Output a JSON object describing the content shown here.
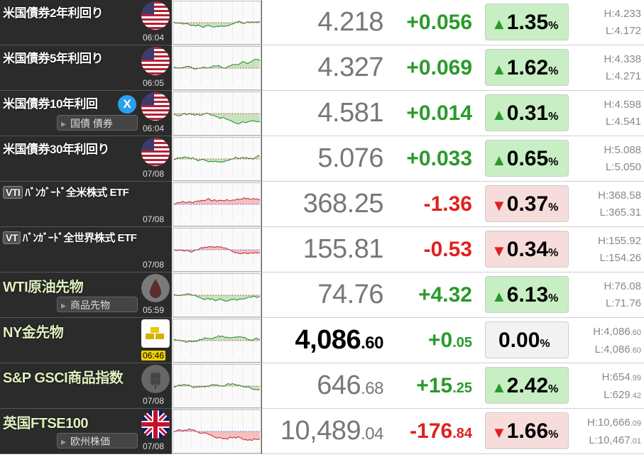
{
  "rows": [
    {
      "name": "米国債券2年利回り",
      "icon": "us-flag-icon",
      "time": "06:04",
      "price": "4.218",
      "change": "+0.056",
      "pct": "1.35",
      "dir": "up",
      "high": "H:4.233",
      "low": "L:4.172"
    },
    {
      "name": "米国債券5年利回り",
      "icon": "us-flag-icon",
      "time": "06:05",
      "price": "4.327",
      "change": "+0.069",
      "pct": "1.62",
      "dir": "up",
      "high": "H:4.338",
      "low": "L:4.271"
    },
    {
      "name": "米国債券10年利回",
      "icon": "us-flag-icon",
      "time": "06:04",
      "price": "4.581",
      "change": "+0.014",
      "pct": "0.31",
      "dir": "up",
      "high": "H:4.598",
      "low": "L:4.541",
      "tag": "国債 債券",
      "x": "X"
    },
    {
      "name": "米国債券30年利回り",
      "icon": "us-flag-icon",
      "time": "07/08",
      "price": "5.076",
      "change": "+0.033",
      "pct": "0.65",
      "dir": "up",
      "high": "H:5.088",
      "low": "L:5.050"
    },
    {
      "name": "ﾊﾞﾝｶﾞｰﾄﾞ全米株式 ETF",
      "badge": "VTI",
      "time": "07/08",
      "price": "368.25",
      "change": "-1.36",
      "pct": "0.37",
      "dir": "down",
      "high": "H:368.58",
      "low": "L:365.31"
    },
    {
      "name": "ﾊﾞﾝｶﾞｰﾄﾞ全世界株式 ETF",
      "badge": "VT",
      "time": "07/08",
      "price": "155.81",
      "change": "-0.53",
      "pct": "0.34",
      "dir": "down",
      "high": "H:155.92",
      "low": "L:154.26"
    },
    {
      "name": "WTI原油先物",
      "icon": "oil-drop-icon",
      "time": "05:59",
      "price": "74.76",
      "change": "+4.32",
      "pct": "6.13",
      "dir": "up",
      "high": "H:76.08",
      "low": "L:71.76",
      "tag": "商品先物"
    },
    {
      "name": "NY金先物",
      "icon": "gold-bars-icon",
      "time": "06:46",
      "price_int": "4,086",
      "price_dec": ".60",
      "change_int": "+0",
      "change_dec": ".05",
      "pct": "0.00",
      "dir": "flat",
      "high_int": "H:4,086",
      "high_dec": ".60",
      "low_int": "L:4,086",
      "low_dec": ".60"
    },
    {
      "name": "S&P GSCI商品指数",
      "icon": "wheat-icon",
      "time": "07/08",
      "price_int": "646",
      "price_dec": ".68",
      "change_int": "+15",
      "change_dec": ".25",
      "pct": "2.42",
      "dir": "up",
      "high_int": "H:654",
      "high_dec": ".99",
      "low_int": "L:629",
      "low_dec": ".42"
    },
    {
      "name": "英国FTSE100",
      "icon": "uk-flag-icon",
      "time": "07/08",
      "price_int": "10,489",
      "price_dec": ".04",
      "change_int": "-176",
      "change_dec": ".84",
      "pct": "1.66",
      "dir": "down",
      "high_int": "H:10,666",
      "high_dec": ".09",
      "low_int": "L:10,467",
      "low_dec": ".01",
      "tag": "欧州株価"
    }
  ],
  "symbols": {
    "up": "▲",
    "down": "▼",
    "unit": "%"
  },
  "colors": {
    "up": "#2a9a2a",
    "down": "#e02020",
    "up_bg": "#c8eec4",
    "down_bg": "#f7dcdc"
  }
}
